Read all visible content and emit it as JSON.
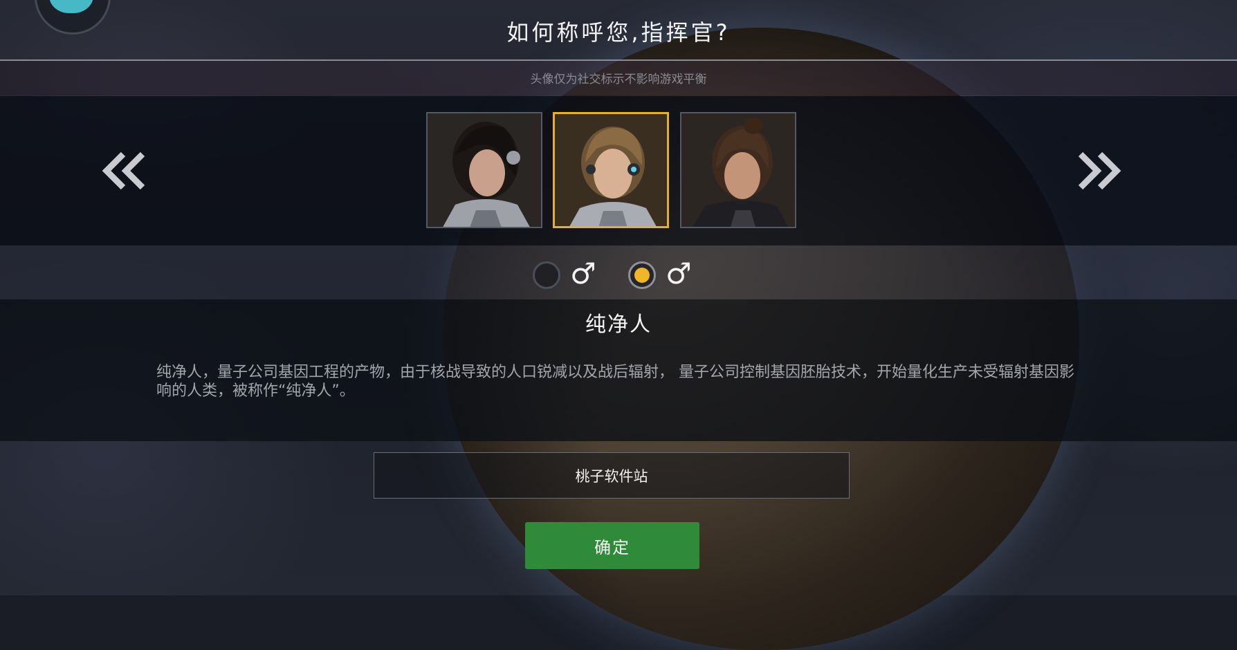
{
  "header": {
    "title": "如何称呼您,指挥官?",
    "subtitle": "头像仅为社交标示不影响游戏平衡"
  },
  "avatars": [
    {
      "name": "avatar-1",
      "selected": false
    },
    {
      "name": "avatar-2",
      "selected": true
    },
    {
      "name": "avatar-3",
      "selected": false
    }
  ],
  "nav": {
    "prev_icon": "double-chevron-left-icon",
    "next_icon": "double-chevron-right-icon"
  },
  "gender": {
    "options": [
      {
        "icon": "♂",
        "selected": false
      },
      {
        "icon": "♂",
        "selected": true
      }
    ]
  },
  "race": {
    "name": "纯净人",
    "description": "纯净人，量子公司基因工程的产物，由于核战导致的人口锐减以及战后辐射， 量子公司控制基因胚胎技术，开始量化生产未受辐射基因影响的人类，被称作“纯净人”。"
  },
  "name_input": {
    "value": "桃子软件站"
  },
  "confirm": {
    "label": "确定",
    "color": "#2f8a3a"
  },
  "colors": {
    "accent": "#e2b12e",
    "radio_dot": "#f0b627"
  }
}
